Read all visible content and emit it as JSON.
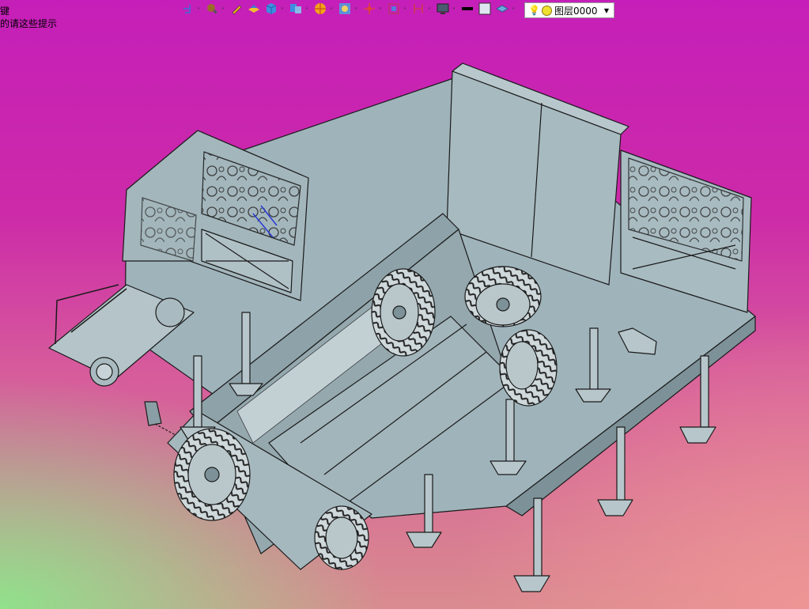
{
  "hint": {
    "line1": "键",
    "line2": "的请这些提示"
  },
  "toolbar": {
    "tools": [
      {
        "icon": "view-orientation-icon"
      },
      {
        "icon": "zoom-fit-icon"
      },
      {
        "icon": "sketch-pencil-icon"
      },
      {
        "icon": "section-view-icon"
      },
      {
        "icon": "display-style-cube-icon"
      },
      {
        "icon": "hide-show-items-icon"
      },
      {
        "icon": "edit-appearance-icon"
      },
      {
        "icon": "apply-scene-icon"
      },
      {
        "icon": "view-settings-icon"
      },
      {
        "icon": "rotate-view-icon"
      },
      {
        "icon": "dimension-icon"
      },
      {
        "icon": "monitor-icon"
      },
      {
        "icon": "line-color-icon"
      },
      {
        "icon": "fill-color-icon"
      },
      {
        "icon": "layer-stack-icon"
      }
    ],
    "layer_select": {
      "value": "图层0000"
    }
  },
  "colors": {
    "model_face": "#9fb3ba",
    "model_light": "#b6c6cb",
    "model_dark": "#7d9198",
    "edge": "#1a1a1a",
    "tire": "#2a2a2a"
  }
}
